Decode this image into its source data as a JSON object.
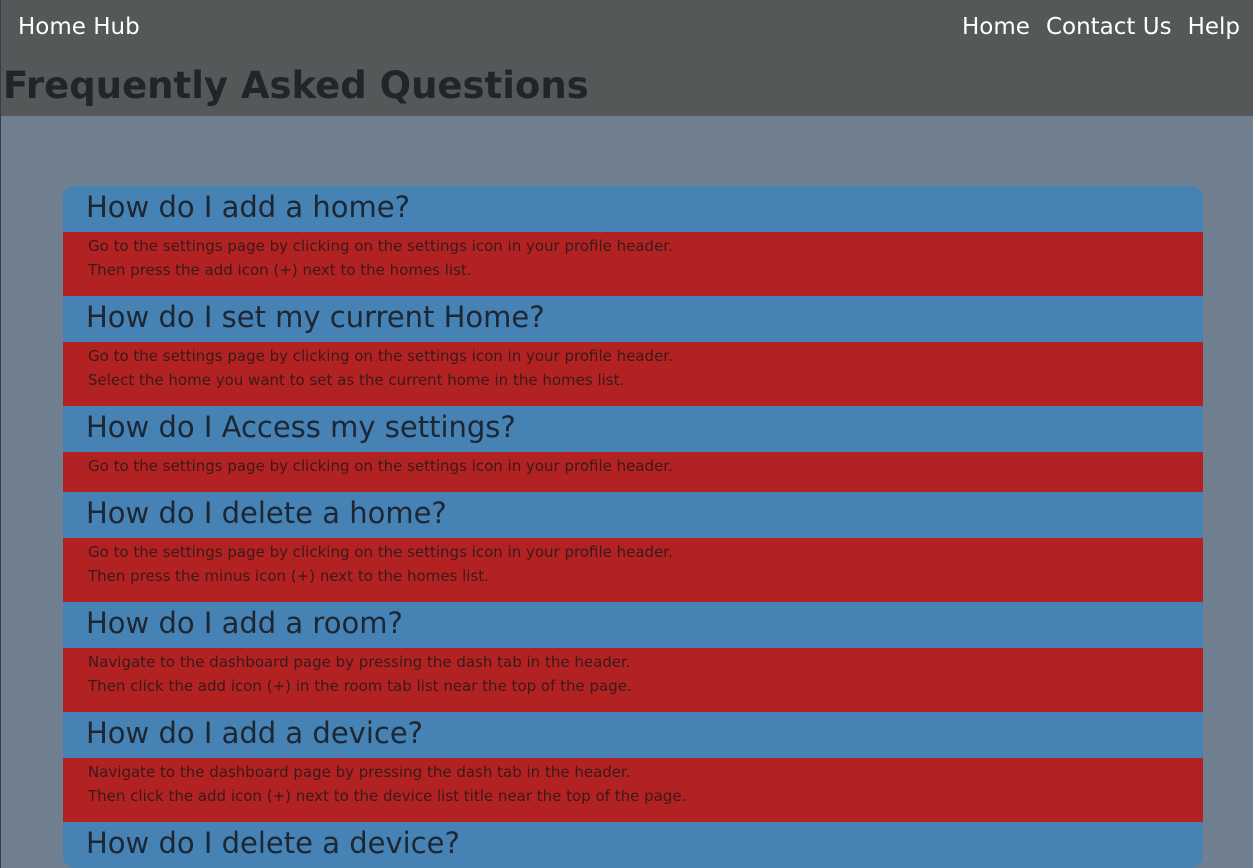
{
  "nav": {
    "brand": "Home Hub",
    "links": [
      "Home",
      "Contact Us",
      "Help"
    ]
  },
  "page_title": "Frequently Asked Questions",
  "colors": {
    "header_bg": "#545859",
    "page_bg": "#708090",
    "question_bg": "#4682b4",
    "answer_bg": "#b22222"
  },
  "faq": [
    {
      "question": "How do I add a home?",
      "answer": [
        "Go to the settings page by clicking on the settings icon in your profile header.",
        "Then press the add icon (+) next to the homes list."
      ]
    },
    {
      "question": "How do I set my current Home?",
      "answer": [
        "Go to the settings page by clicking on the settings icon in your profile header.",
        "Select the home you want to set as the current home in the homes list."
      ]
    },
    {
      "question": "How do I Access my settings?",
      "answer": [
        "Go to the settings page by clicking on the settings icon in your profile header."
      ]
    },
    {
      "question": "How do I delete a home?",
      "answer": [
        "Go to the settings page by clicking on the settings icon in your profile header.",
        "Then press the minus icon (+) next to the homes list."
      ]
    },
    {
      "question": "How do I add a room?",
      "answer": [
        "Navigate to the dashboard page by pressing the dash tab in the header.",
        "Then click the add icon (+) in the room tab list near the top of the page."
      ]
    },
    {
      "question": "How do I add a device?",
      "answer": [
        "Navigate to the dashboard page by pressing the dash tab in the header.",
        "Then click the add icon (+) next to the device list title near the top of the page."
      ]
    },
    {
      "question": "How do I delete a device?",
      "answer": []
    }
  ]
}
